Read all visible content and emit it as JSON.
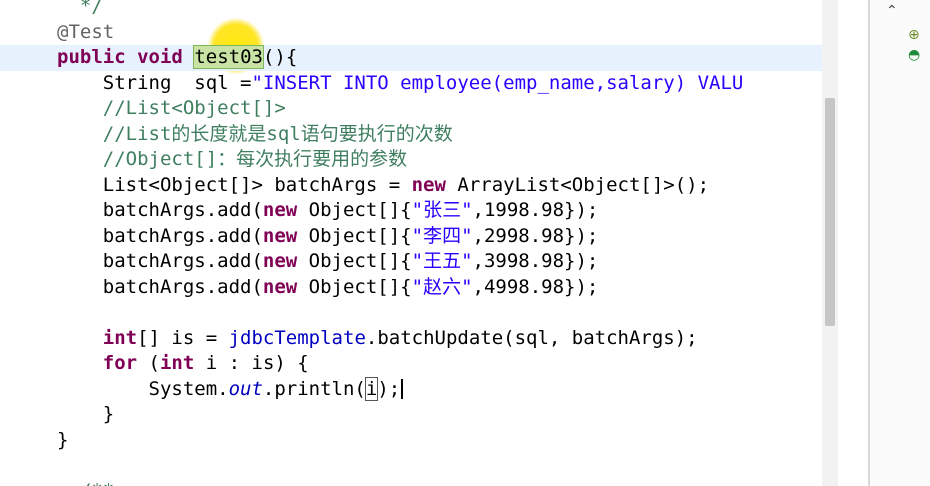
{
  "editor": {
    "lines": [
      {
        "segments": [
          {
            "t": "  */",
            "c": "cm"
          }
        ]
      },
      {
        "segments": [
          {
            "t": "@Test",
            "c": "ann"
          }
        ]
      },
      {
        "segments": [
          {
            "t": "public",
            "c": "kw"
          },
          {
            "t": " "
          },
          {
            "t": "void",
            "c": "kw"
          },
          {
            "t": " "
          },
          {
            "t": "test03",
            "c": "sel"
          },
          {
            "t": "(){"
          }
        ],
        "current": true
      },
      {
        "segments": [
          {
            "t": "    String  sql ="
          },
          {
            "t": "\"INSERT INTO employee(emp_name,salary) VALU",
            "c": "str"
          }
        ]
      },
      {
        "segments": [
          {
            "t": "    //List<Object[]>",
            "c": "cm"
          }
        ]
      },
      {
        "segments": [
          {
            "t": "    //List的长度就是sql语句要执行的次数",
            "c": "cm"
          }
        ]
      },
      {
        "segments": [
          {
            "t": "    //Object[]：每次执行要用的参数",
            "c": "cm"
          }
        ]
      },
      {
        "segments": [
          {
            "t": "    List<Object[]> batchArgs = "
          },
          {
            "t": "new",
            "c": "kw"
          },
          {
            "t": " ArrayList<Object[]>();"
          }
        ]
      },
      {
        "segments": [
          {
            "t": "    batchArgs.add("
          },
          {
            "t": "new",
            "c": "kw"
          },
          {
            "t": " Object[]{"
          },
          {
            "t": "\"张三\"",
            "c": "str"
          },
          {
            "t": ",1998.98});"
          }
        ]
      },
      {
        "segments": [
          {
            "t": "    batchArgs.add("
          },
          {
            "t": "new",
            "c": "kw"
          },
          {
            "t": " Object[]{"
          },
          {
            "t": "\"李四\"",
            "c": "str"
          },
          {
            "t": ",2998.98});"
          }
        ]
      },
      {
        "segments": [
          {
            "t": "    batchArgs.add("
          },
          {
            "t": "new",
            "c": "kw"
          },
          {
            "t": " Object[]{"
          },
          {
            "t": "\"王五\"",
            "c": "str"
          },
          {
            "t": ",3998.98});"
          }
        ]
      },
      {
        "segments": [
          {
            "t": "    batchArgs.add("
          },
          {
            "t": "new",
            "c": "kw"
          },
          {
            "t": " Object[]{"
          },
          {
            "t": "\"赵六\"",
            "c": "str"
          },
          {
            "t": ",4998.98});"
          }
        ]
      },
      {
        "segments": []
      },
      {
        "segments": [
          {
            "t": "    "
          },
          {
            "t": "int",
            "c": "kw"
          },
          {
            "t": "[] is = "
          },
          {
            "t": "jdbcTemplate",
            "c": "fld"
          },
          {
            "t": ".batchUpdate(sql, batchArgs);"
          }
        ]
      },
      {
        "segments": [
          {
            "t": "    "
          },
          {
            "t": "for",
            "c": "kw"
          },
          {
            "t": " ("
          },
          {
            "t": "int",
            "c": "kw"
          },
          {
            "t": " i : is) {"
          }
        ]
      },
      {
        "segments": [
          {
            "t": "        System."
          },
          {
            "t": "out",
            "c": "it"
          },
          {
            "t": ".println("
          },
          {
            "t": "i",
            "c": "box"
          },
          {
            "t": ");"
          },
          {
            "t": "",
            "c": "caret"
          }
        ]
      },
      {
        "segments": [
          {
            "t": "    }"
          }
        ]
      },
      {
        "segments": [
          {
            "t": "}"
          }
        ]
      },
      {
        "segments": []
      },
      {
        "segments": [
          {
            "t": "  /**",
            "c": "cm"
          }
        ]
      }
    ]
  },
  "outline": {
    "icons": [
      "chevron-up-icon",
      "class-icon",
      "method-icon"
    ]
  },
  "colors": {
    "keyword": "#7f0055",
    "string": "#2a00ff",
    "comment": "#3f7f5f",
    "annotation": "#646464",
    "current_line": "#e8f2fe",
    "selection": "#c8e3a3"
  }
}
